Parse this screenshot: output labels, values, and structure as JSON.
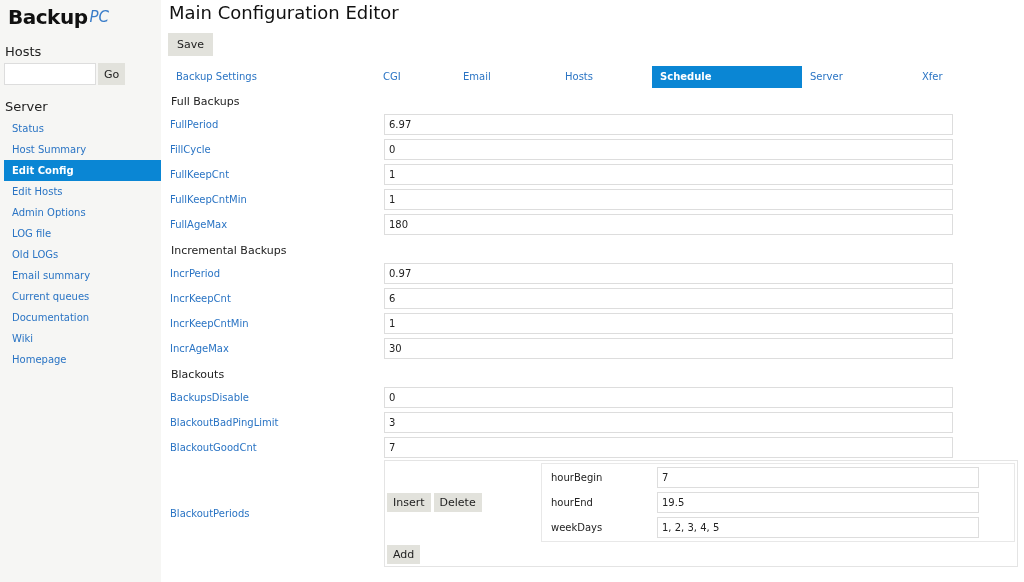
{
  "logo": {
    "main": "Backup",
    "suffix": "PC"
  },
  "sidebar": {
    "hosts_title": "Hosts",
    "go_button": "Go",
    "server_title": "Server",
    "items": [
      {
        "label": "Status",
        "selected": false
      },
      {
        "label": "Host Summary",
        "selected": false
      },
      {
        "label": "Edit Config",
        "selected": true
      },
      {
        "label": "Edit Hosts",
        "selected": false
      },
      {
        "label": "Admin Options",
        "selected": false
      },
      {
        "label": "LOG file",
        "selected": false
      },
      {
        "label": "Old LOGs",
        "selected": false
      },
      {
        "label": "Email summary",
        "selected": false
      },
      {
        "label": "Current queues",
        "selected": false
      },
      {
        "label": "Documentation",
        "selected": false
      },
      {
        "label": "Wiki",
        "selected": false
      },
      {
        "label": "Homepage",
        "selected": false
      }
    ]
  },
  "title": "Main Configuration Editor",
  "save_button": "Save",
  "tabs": [
    {
      "label": "Backup Settings",
      "selected": false
    },
    {
      "label": "CGI",
      "selected": false
    },
    {
      "label": "Email",
      "selected": false
    },
    {
      "label": "Hosts",
      "selected": false
    },
    {
      "label": "Schedule",
      "selected": true
    },
    {
      "label": "Server",
      "selected": false
    },
    {
      "label": "Xfer",
      "selected": false
    }
  ],
  "sections": [
    {
      "title": "Full Backups",
      "fields": [
        {
          "label": "FullPeriod",
          "value": "6.97"
        },
        {
          "label": "FillCycle",
          "value": "0"
        },
        {
          "label": "FullKeepCnt",
          "value": "1"
        },
        {
          "label": "FullKeepCntMin",
          "value": "1"
        },
        {
          "label": "FullAgeMax",
          "value": "180"
        }
      ]
    },
    {
      "title": "Incremental Backups",
      "fields": [
        {
          "label": "IncrPeriod",
          "value": "0.97"
        },
        {
          "label": "IncrKeepCnt",
          "value": "6"
        },
        {
          "label": "IncrKeepCntMin",
          "value": "1"
        },
        {
          "label": "IncrAgeMax",
          "value": "30"
        }
      ]
    },
    {
      "title": "Blackouts",
      "fields": [
        {
          "label": "BackupsDisable",
          "value": "0"
        },
        {
          "label": "BlackoutBadPingLimit",
          "value": "3"
        },
        {
          "label": "BlackoutGoodCnt",
          "value": "7"
        }
      ]
    }
  ],
  "blackout_periods": {
    "label": "BlackoutPeriods",
    "insert_button": "Insert",
    "delete_button": "Delete",
    "add_button": "Add",
    "fields": [
      {
        "label": "hourBegin",
        "value": "7"
      },
      {
        "label": "hourEnd",
        "value": "19.5"
      },
      {
        "label": "weekDays",
        "value": "1, 2, 3, 4, 5"
      }
    ]
  }
}
